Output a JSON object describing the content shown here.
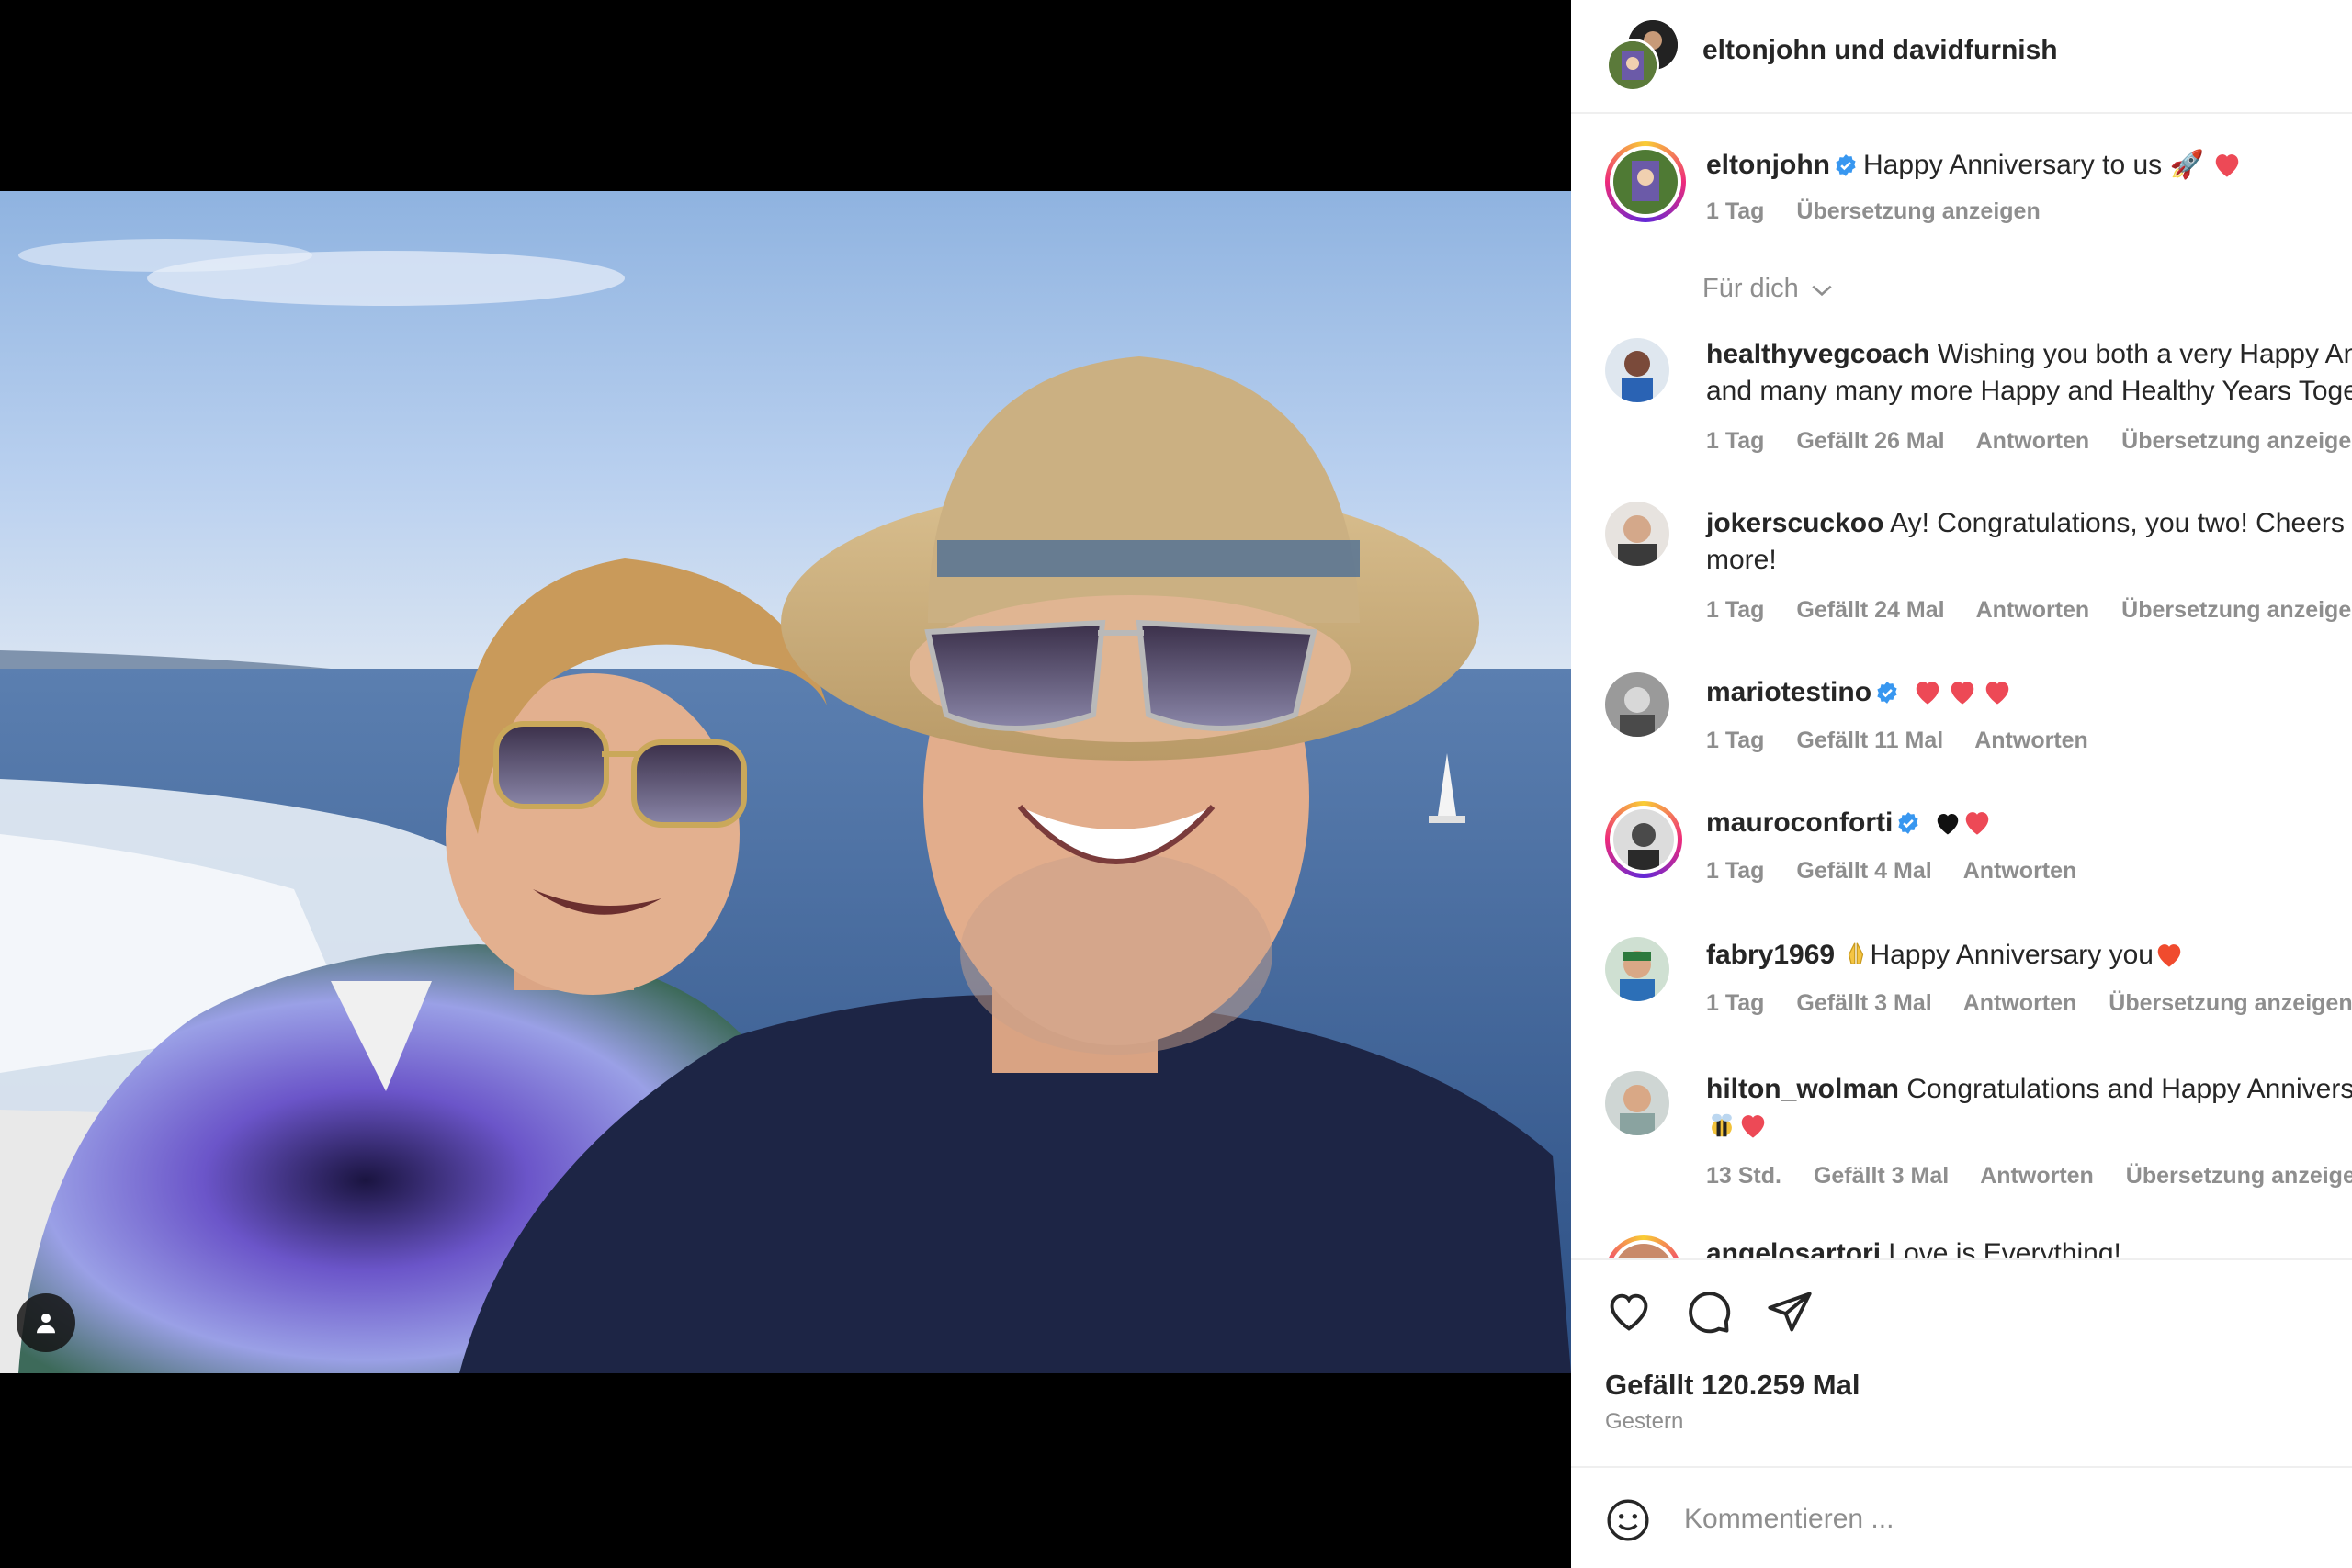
{
  "header": {
    "title": "eltonjohn und davidfurnish"
  },
  "caption": {
    "username": "eltonjohn",
    "text": "Happy Anniversary to us 🚀",
    "time": "1 Tag",
    "translate": "Übersetzung anzeigen"
  },
  "sort": {
    "label": "Für dich"
  },
  "comments": [
    {
      "username": "healthyvegcoach",
      "text": "Wishing you both a very Happy Anniversary",
      "text2": "and many many more Happy and Healthy Years Together",
      "time": "1 Tag",
      "likes": "Gefällt 26 Mal",
      "reply": "Antworten",
      "translate": "Übersetzung anzeigen"
    },
    {
      "username": "jokerscuckoo",
      "text": "Ay! Congratulations, you two! Cheers to many",
      "text2": "more!",
      "time": "1 Tag",
      "likes": "Gefällt 24 Mal",
      "reply": "Antworten",
      "translate": "Übersetzung anzeigen"
    },
    {
      "username": "mariotestino",
      "text": "",
      "time": "1 Tag",
      "likes": "Gefällt 11 Mal",
      "reply": "Antworten"
    },
    {
      "username": "mauroconforti",
      "text": "",
      "time": "1 Tag",
      "likes": "Gefällt 4 Mal",
      "reply": "Antworten"
    },
    {
      "username": "fabry1969",
      "text": "Happy Anniversary you",
      "time": "1 Tag",
      "likes": "Gefällt 3 Mal",
      "reply": "Antworten",
      "translate": "Übersetzung anzeigen"
    },
    {
      "username": "hilton_wolman",
      "text": "Congratulations and Happy Anniversary",
      "time": "13 Std.",
      "likes": "Gefällt 3 Mal",
      "reply": "Antworten",
      "translate": "Übersetzung anzeigen"
    },
    {
      "username": "angelosartori",
      "text": "Love is Everything!"
    }
  ],
  "actions": {
    "like_icon": "heart-icon",
    "comment_icon": "comment-icon",
    "share_icon": "send-icon"
  },
  "likes": {
    "label": "Gefällt 120.259 Mal",
    "date": "Gestern"
  },
  "add_comment": {
    "placeholder": "Kommentieren ...",
    "emoji_icon": "emoji-icon"
  },
  "colors": {
    "verified": "#3897f0",
    "heart": "#ed4956",
    "muted": "#8e8e8e"
  }
}
